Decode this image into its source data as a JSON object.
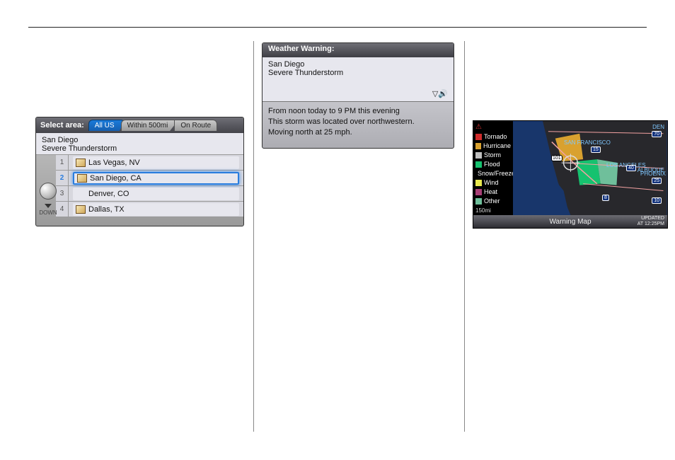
{
  "panel1": {
    "title": "Select area:",
    "tabs": [
      {
        "label": "All US",
        "active": true
      },
      {
        "label": "Within 500mi",
        "active": false
      },
      {
        "label": "On Route",
        "active": false
      }
    ],
    "info_city": "San Diego",
    "info_event": "Severe Thunderstorm",
    "items": [
      {
        "num": "1",
        "name": "Las Vegas, NV",
        "has_map": true,
        "selected": false
      },
      {
        "num": "2",
        "name": "San Diego, CA",
        "has_map": true,
        "selected": true
      },
      {
        "num": "3",
        "name": "Denver, CO",
        "has_map": false,
        "selected": false
      },
      {
        "num": "4",
        "name": "Dallas, TX",
        "has_map": true,
        "selected": false
      }
    ],
    "down_label": "DOWN"
  },
  "panel2": {
    "header": "Weather Warning:",
    "city": "San Diego",
    "event": "Severe Thunderstorm",
    "body_line1": "From noon today to 9 PM this evening",
    "body_line2": "This storm was located over northwestern.",
    "body_line3": "Moving north at 25 mph."
  },
  "panel3": {
    "legend": [
      {
        "label": "Tornado",
        "color": "#d02c2c"
      },
      {
        "label": "Hurricane",
        "color": "#d9a12f"
      },
      {
        "label": "Storm",
        "color": "#c0c0c0"
      },
      {
        "label": "Flood",
        "color": "#16c26f"
      },
      {
        "label": "Snow/Freeze",
        "color": "#39a7e0"
      },
      {
        "label": "Wind",
        "color": "#e9e94f"
      },
      {
        "label": "Heat",
        "color": "#a83f76"
      },
      {
        "label": "Other",
        "color": "#6fbf9b"
      }
    ],
    "scale": "150mi",
    "footer_title": "Warning Map",
    "updated_label": "UPDATED",
    "updated_at": "AT 12:25PM",
    "city_labels": {
      "sf": "SAN FRANCISCO",
      "la": "LOS ANGELES",
      "ph": "PHOENIX",
      "alb": "ALBUQUE",
      "de": "DEN"
    },
    "routes": [
      "101"
    ],
    "interstates": [
      "70",
      "15",
      "40",
      "25",
      "10",
      "8"
    ]
  }
}
